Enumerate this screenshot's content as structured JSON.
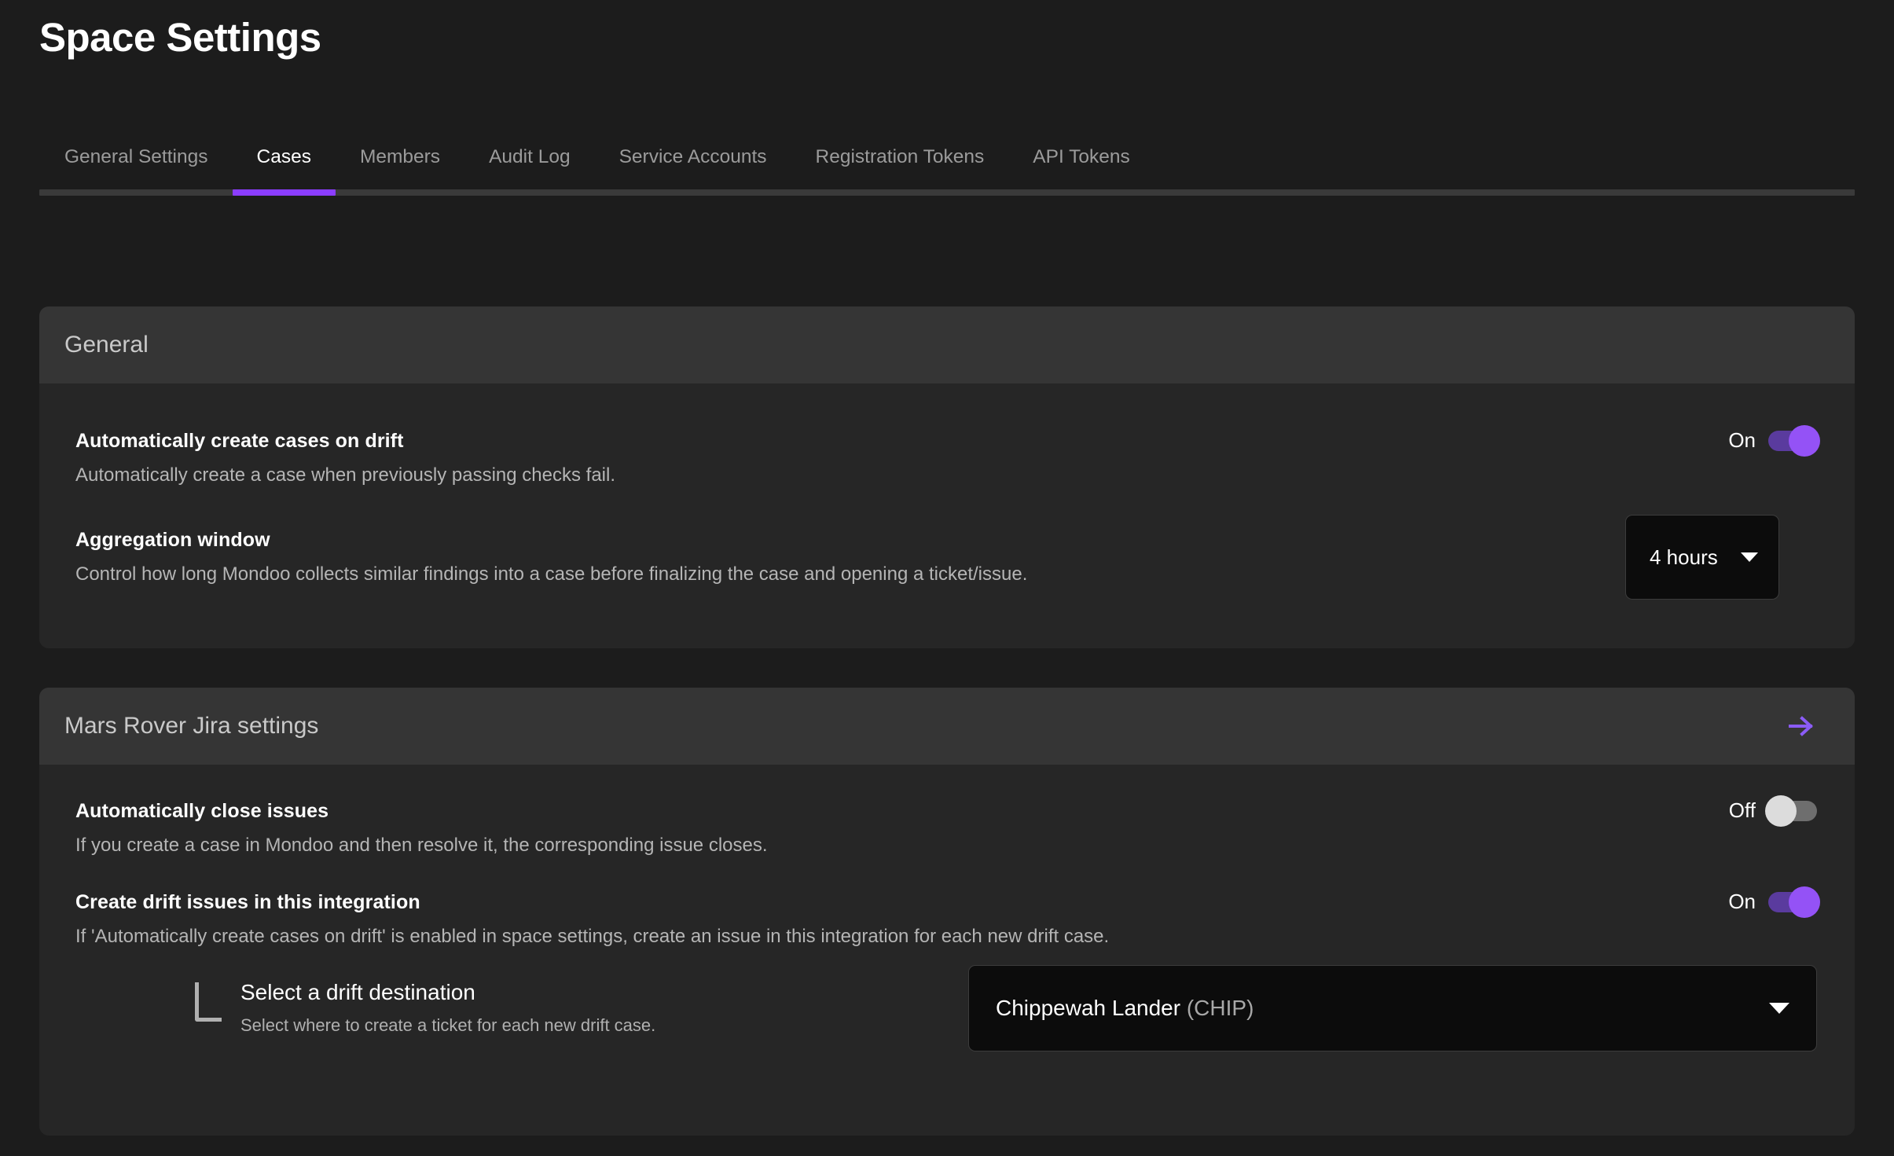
{
  "header": {
    "title": "Space Settings"
  },
  "tabs": [
    {
      "label": "General Settings",
      "active": false
    },
    {
      "label": "Cases",
      "active": true
    },
    {
      "label": "Members",
      "active": false
    },
    {
      "label": "Audit Log",
      "active": false
    },
    {
      "label": "Service Accounts",
      "active": false
    },
    {
      "label": "Registration Tokens",
      "active": false
    },
    {
      "label": "API Tokens",
      "active": false
    }
  ],
  "colors": {
    "accent": "#8b3dff",
    "toggle_on_knob": "#9452f6",
    "toggle_on_track": "#5a3b9e",
    "toggle_off_knob": "#dcdcdc",
    "toggle_off_track": "#6e6e6e",
    "page_bg": "#1c1c1c",
    "card_bg": "#262626",
    "card_header_bg": "#353535"
  },
  "general_card": {
    "title": "General",
    "drift": {
      "title": "Automatically create cases on drift",
      "description": "Automatically create a case when previously passing checks fail.",
      "toggle_label": "On",
      "toggle_state": "on"
    },
    "aggregation": {
      "title": "Aggregation window",
      "description": "Control how long Mondoo collects similar findings into a case before finalizing the case and opening a ticket/issue.",
      "value": "4 hours"
    }
  },
  "jira_card": {
    "title": "Mars Rover Jira settings",
    "header_icon": "arrow-right-icon",
    "auto_close": {
      "title": "Automatically close issues",
      "description": "If you create a case in Mondoo and then resolve it, the corresponding issue closes.",
      "toggle_label": "Off",
      "toggle_state": "off"
    },
    "create_drift": {
      "title": "Create drift issues in this integration",
      "description": "If 'Automatically create cases on drift' is enabled in space settings, create an issue in this integration for each new drift case.",
      "toggle_label": "On",
      "toggle_state": "on"
    },
    "drift_destination": {
      "title": "Select a drift destination",
      "description": "Select where to create a ticket for each new drift case.",
      "value_name": "Chippewah Lander",
      "value_key": "(CHIP)"
    }
  }
}
